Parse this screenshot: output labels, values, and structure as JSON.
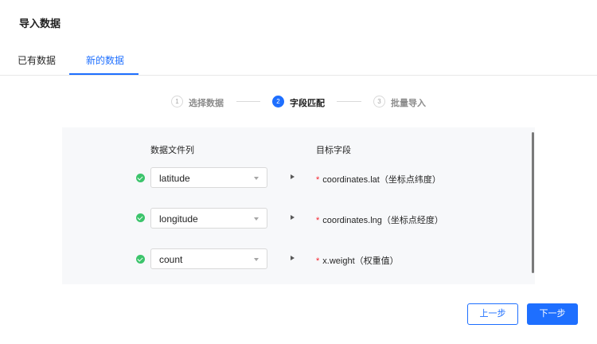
{
  "dialog": {
    "title": "导入数据"
  },
  "tabs": [
    {
      "label": "已有数据",
      "active": false
    },
    {
      "label": "新的数据",
      "active": true
    }
  ],
  "steps": [
    {
      "number": "1",
      "label": "选择数据",
      "active": false
    },
    {
      "number": "2",
      "label": "字段匹配",
      "active": true
    },
    {
      "number": "3",
      "label": "批量导入",
      "active": false
    }
  ],
  "mapping": {
    "source_header": "数据文件列",
    "target_header": "目标字段",
    "rows": [
      {
        "source": "latitude",
        "required_mark": "*",
        "target": "coordinates.lat（坐标点纬度）"
      },
      {
        "source": "longitude",
        "required_mark": "*",
        "target": "coordinates.lng（坐标点经度）"
      },
      {
        "source": "count",
        "required_mark": "*",
        "target": "x.weight（权重值）"
      }
    ]
  },
  "footer": {
    "prev_label": "上一步",
    "next_label": "下一步"
  },
  "colors": {
    "accent": "#1e6fff",
    "success": "#3bc46b",
    "required": "#f5222d"
  },
  "icons": {
    "check": "check-circle-icon",
    "caret": "caret-down-icon",
    "arrow": "arrow-right-icon"
  }
}
